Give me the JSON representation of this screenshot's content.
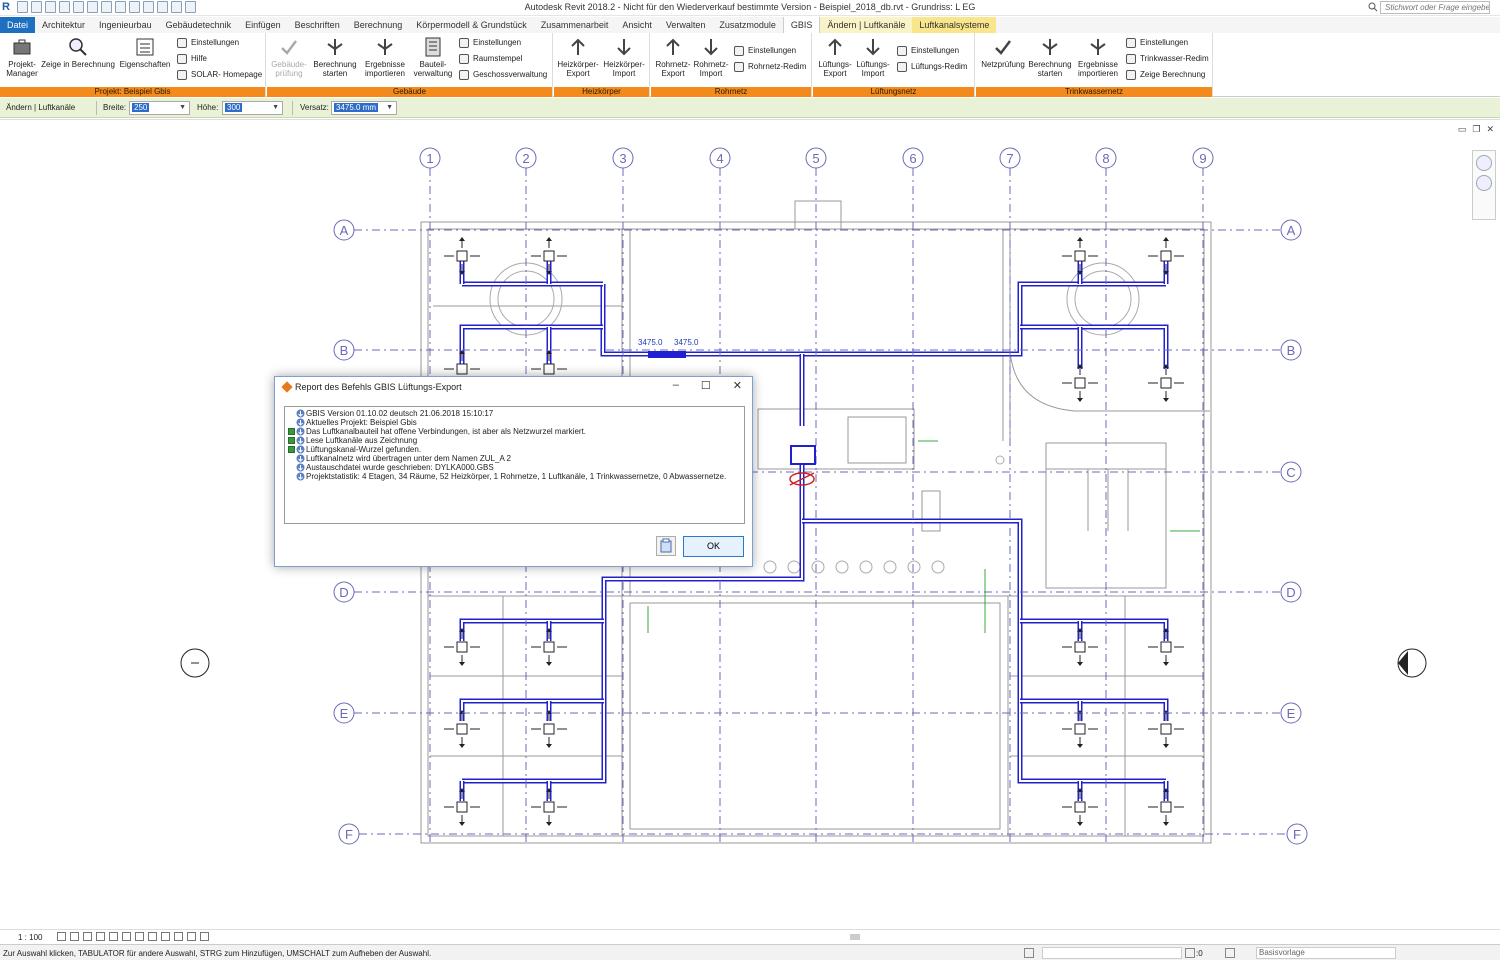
{
  "title_bar": {
    "app_title": "Autodesk Revit 2018.2 - Nicht für den Wiederverkauf bestimmte Version -     Beispiel_2018_db.rvt - Grundriss: L EG",
    "search_placeholder": "Stichwort oder Frage eingeben",
    "logo": "R"
  },
  "tabs": [
    "Datei",
    "Architektur",
    "Ingenieurbau",
    "Gebäudetechnik",
    "Einfügen",
    "Beschriften",
    "Berechnung",
    "Körpermodell & Grundstück",
    "Zusammenarbeit",
    "Ansicht",
    "Verwalten",
    "Zusatzmodule",
    "GBIS",
    "Ändern | Luftkanäle",
    "Luftkanalsysteme"
  ],
  "ribbon": {
    "panels": [
      {
        "label": "Projekt: Beispiel Gbis"
      },
      {
        "label": "Gebäude"
      },
      {
        "label": "Heizkörper"
      },
      {
        "label": "Rohrnetz"
      },
      {
        "label": "Lüftungsnetz"
      },
      {
        "label": "Trinkwassernetz"
      }
    ],
    "big_buttons": {
      "projekt_manager": "Projekt-\nManager",
      "zeige_berechnung": "Zeige in Berechnung",
      "eigenschaften": "Eigenschaften",
      "gebaeudepruefung": "Gebäude-\nprüfung",
      "berechnung_starten": "Berechnung\nstarten",
      "ergebnisse_importieren": "Ergebnisse\nimportieren",
      "bauteilverwaltung": "Bauteil-\nverwaltung",
      "hk_export": "Heizkörper-\nExport",
      "hk_import": "Heizkörper-\nImport",
      "rn_export": "Rohrnetz-\nExport",
      "rn_import": "Rohrnetz-\nImport",
      "lf_export": "Lüftungs-\nExport",
      "lf_import": "Lüftungs-\nImport",
      "netzpruefung": "Netzprüfung",
      "tw_berechnung": "Berechnung\nstarten",
      "tw_ergebnisse": "Ergebnisse\nimportieren"
    },
    "small_buttons": {
      "p_einstellungen": "Einstellungen",
      "p_hilfe": "Hilfe",
      "p_solar": "SOLAR- Homepage",
      "g_einstellungen": "Einstellungen",
      "g_raumstempel": "Raumstempel",
      "g_geschoss": "Geschossverwaltung",
      "r_einstellungen": "Einstellungen",
      "r_redim": "Rohrnetz-Redim",
      "l_einstellungen": "Einstellungen",
      "l_redim": "Lüftungs-Redim",
      "t_einstellungen": "Einstellungen",
      "t_redim": "Trinkwasser-Redim",
      "t_zeige": "Zeige Berechnung"
    }
  },
  "options_bar": {
    "context": "Ändern | Luftkanäle",
    "breite_label": "Breite:",
    "breite_value": "250",
    "hoehe_label": "Höhe:",
    "hoehe_value": "300",
    "versatz_label": "Versatz:",
    "versatz_value": "3475.0 mm"
  },
  "plan": {
    "grid_numbers": [
      "1",
      "2",
      "3",
      "4",
      "5",
      "6",
      "7",
      "8",
      "9"
    ],
    "grid_letters": [
      "A",
      "B",
      "C",
      "D",
      "E",
      "F"
    ],
    "dimension_labels": [
      "3475.0",
      "3475.0"
    ]
  },
  "dialog": {
    "title": "Report des Befehls GBIS Lüftungs-Export",
    "ok_label": "OK",
    "log": [
      {
        "text": "GBIS Version 01.10.02 deutsch 21.06.2018 15:10:17",
        "ok": false
      },
      {
        "text": "Aktuelles Projekt: Beispiel Gbis",
        "ok": false
      },
      {
        "text": "Das Luftkanalbauteil hat offene Verbindungen, ist aber als Netzwurzel markiert.",
        "ok": true
      },
      {
        "text": "Lese Luftkanäle aus Zeichnung",
        "ok": true
      },
      {
        "text": "Lüftungskanal-Wurzel gefunden.",
        "ok": true
      },
      {
        "text": "Luftkanalnetz wird übertragen unter dem Namen ZUL_A 2",
        "ok": false
      },
      {
        "text": "Austauschdatei wurde geschrieben: DYLKA000.GBS",
        "ok": false
      },
      {
        "text": "Projektstatistik: 4 Etagen, 34 Räume, 52 Heizkörper, 1 Rohrnetze, 1 Luftkanäle, 1 Trinkwassernetze, 0 Abwassernetze.",
        "ok": false
      }
    ]
  },
  "view_bar": {
    "scale": "1 : 100"
  },
  "status_bar": {
    "message": "Zur Auswahl klicken, TABULATOR für andere Auswahl, STRG zum Hinzufügen, UMSCHALT zum Aufheben der Auswahl.",
    "zero": ":0",
    "model": "Basisvorlage"
  },
  "colors": {
    "file_tab": "#1e6fc0",
    "panel_label": "#f28a1c",
    "options_bar": "#e9f2d6",
    "duct": "#2020d0",
    "grid": "#6a6ab8"
  }
}
